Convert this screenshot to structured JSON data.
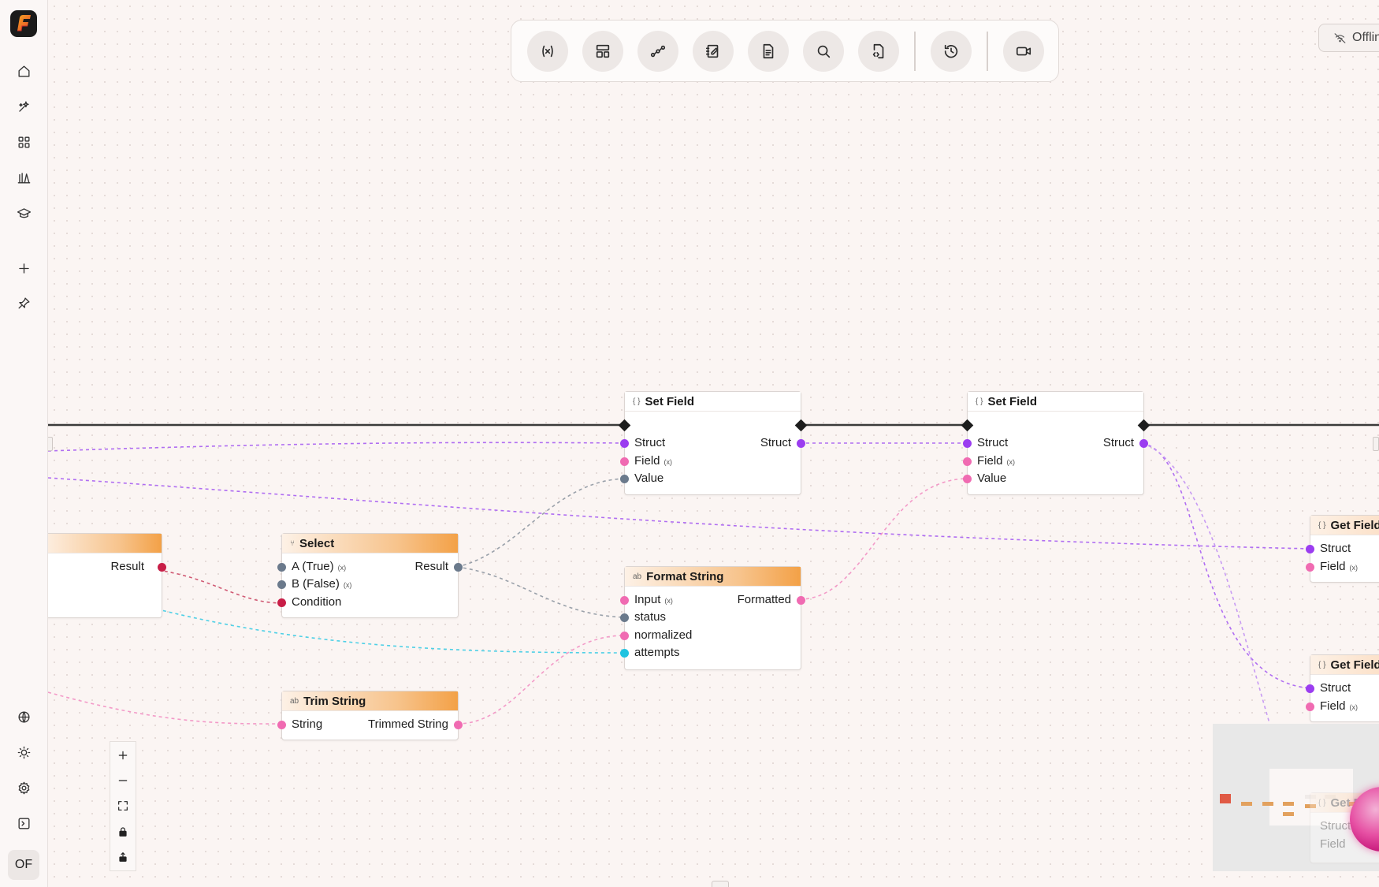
{
  "status": {
    "offline_label": "Offline"
  },
  "sidebar": {
    "avatar_initials": "OF"
  },
  "nodes": {
    "left_partial": {
      "out_result": "Result"
    },
    "set_field_1": {
      "title": "Set Field",
      "in_struct": "Struct",
      "in_field": "Field",
      "in_value": "Value",
      "out_struct": "Struct"
    },
    "set_field_2": {
      "title": "Set Field",
      "in_struct": "Struct",
      "in_field": "Field",
      "in_value": "Value",
      "out_struct": "Struct"
    },
    "select": {
      "title": "Select",
      "in_a": "A (True)",
      "in_b": "B (False)",
      "in_condition": "Condition",
      "out_result": "Result"
    },
    "format_string": {
      "title": "Format String",
      "in_input": "Input",
      "in_status": "status",
      "in_normalized": "normalized",
      "in_attempts": "attempts",
      "out_formatted": "Formatted"
    },
    "trim_string": {
      "title": "Trim String",
      "in_string": "String",
      "out_trimmed": "Trimmed String"
    },
    "get_field_1": {
      "title": "Get Field",
      "in_struct": "Struct",
      "in_field": "Field"
    },
    "get_field_2": {
      "title": "Get Field",
      "in_struct": "Struct",
      "in_field": "Field"
    },
    "get_field_3": {
      "title": "Get Field",
      "in_struct": "Struct",
      "in_field": "Field"
    }
  },
  "colors": {
    "struct_port": "#9b3df0",
    "string_port": "#f06bb2",
    "generic_port": "#6b7a8c",
    "bool_port": "#c81e47",
    "number_port": "#1fc3e0",
    "node_accent": "#f3a147"
  },
  "icons": {
    "toolbar": [
      "variable-icon",
      "layout-icon",
      "workflow-icon",
      "notebook-icon",
      "document-icon",
      "search-icon",
      "code-file-icon",
      "history-icon",
      "video-icon"
    ],
    "sidebar": [
      "home-icon",
      "sparkle-icon",
      "grid-icon",
      "library-icon",
      "graduation-cap-icon",
      "plus-icon",
      "pin-icon",
      "globe-icon",
      "sun-icon",
      "settings-icon",
      "terminal-icon"
    ]
  }
}
